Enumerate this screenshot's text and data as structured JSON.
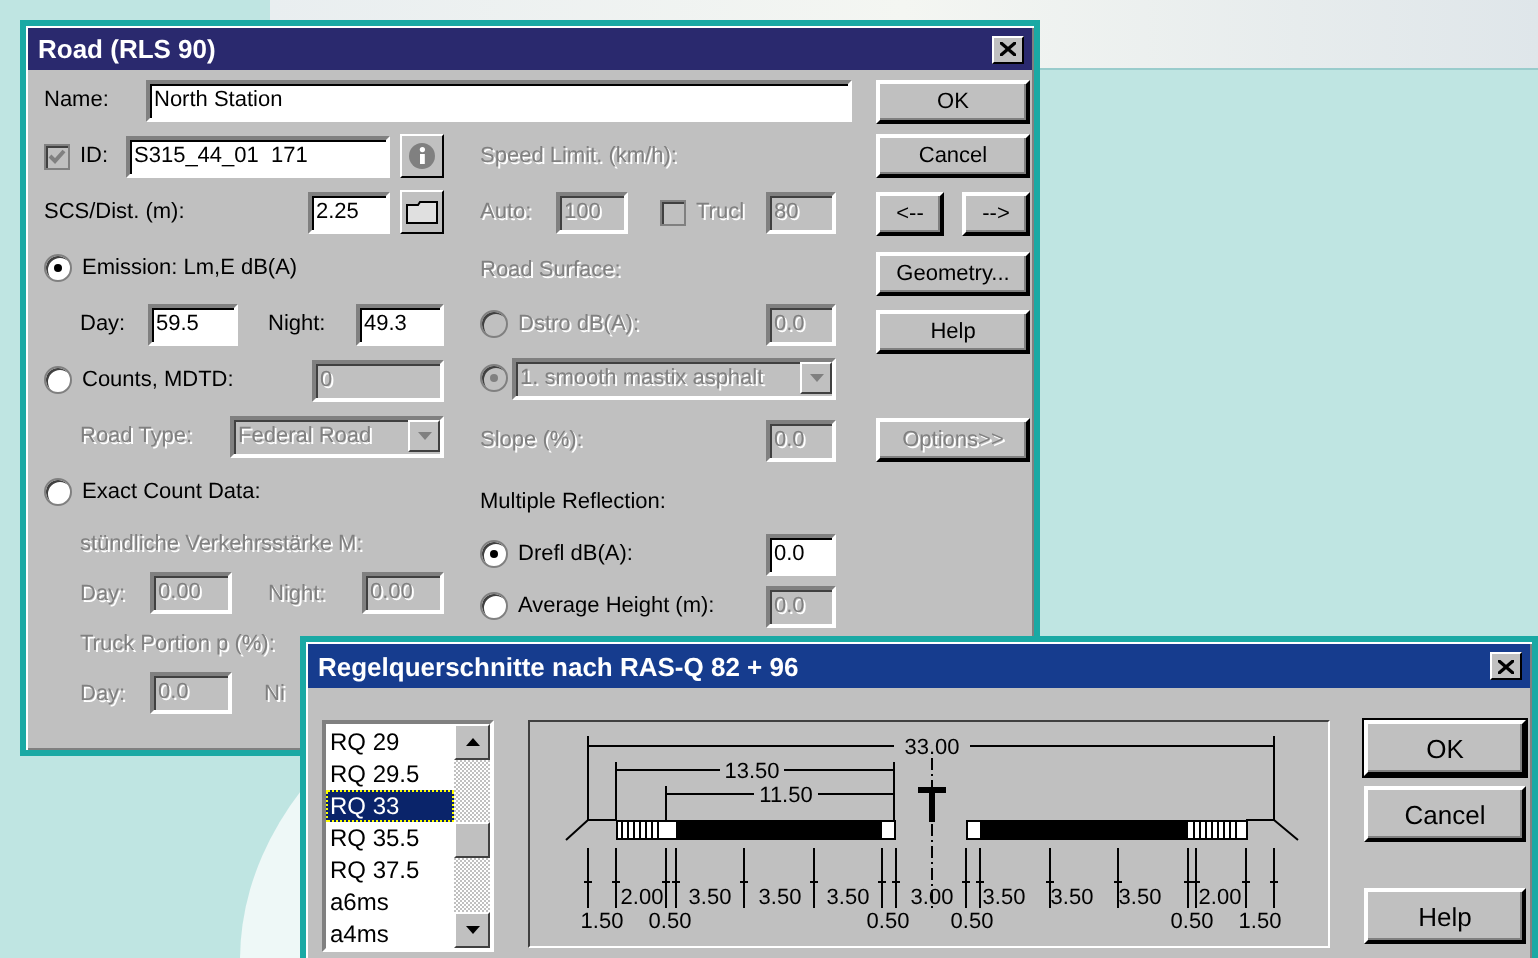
{
  "road_dialog": {
    "title": "Road (RLS 90)",
    "name": {
      "label": "Name:",
      "value": "North Station"
    },
    "id": {
      "label": "ID:",
      "checked": true,
      "value": "S315_44_01  171"
    },
    "scs": {
      "label": "SCS/Dist. (m):",
      "value": "2.25"
    },
    "emission": {
      "label": "Emission: Lm,E dB(A)",
      "selected": true,
      "day": {
        "label": "Day:",
        "value": "59.5"
      },
      "night": {
        "label": "Night:",
        "value": "49.3"
      }
    },
    "counts": {
      "label": "Counts, MDTD:",
      "selected": false,
      "disabled": true,
      "value": "0"
    },
    "road_type": {
      "label": "Road Type:",
      "disabled": true,
      "value": "Federal Road"
    },
    "exact_count": {
      "label": "Exact Count Data:",
      "selected": false
    },
    "hourly": {
      "label": "stündliche Verkehrsstärke M:",
      "disabled": true,
      "day": {
        "label": "Day:",
        "value": "0.00"
      },
      "night": {
        "label": "Night:",
        "value": "0.00"
      }
    },
    "truck_portion": {
      "label": "Truck Portion p (%):",
      "disabled": true,
      "day": {
        "label": "Day:",
        "value": "0.0"
      },
      "night": {
        "label": "Ni"
      }
    },
    "speed_limit": {
      "label": "Speed Limit. (km/h):",
      "disabled": true,
      "auto": {
        "label": "Auto:",
        "value": "100"
      },
      "truck": {
        "label": "Trucl",
        "checked": false,
        "value": "80"
      }
    },
    "road_surface": {
      "label": "Road Surface:",
      "disabled": true,
      "dstro": {
        "label": "Dstro dB(A):",
        "selected": false,
        "value": "0.0"
      },
      "surface": {
        "selected": true,
        "value": "1. smooth mastix asphalt"
      }
    },
    "slope": {
      "label": "Slope (%):",
      "disabled": true,
      "value": "0.0"
    },
    "multiple_reflection": {
      "label": "Multiple Reflection:",
      "drefl": {
        "label": "Drefl dB(A):",
        "selected": true,
        "disabled": false,
        "value": "0.0"
      },
      "average_height": {
        "label": "Average Height (m):",
        "selected": false,
        "disabled": true,
        "value": "0.0"
      }
    },
    "buttons": [
      {
        "label": "OK"
      },
      {
        "label": "Cancel"
      }
    ],
    "nav_buttons": [
      {
        "label": "<--"
      },
      {
        "label": "-->"
      }
    ],
    "more_buttons": [
      {
        "label": "Geometry..."
      },
      {
        "label": "Help"
      }
    ],
    "options": {
      "label": "Options>>",
      "disabled": true
    }
  },
  "cross_section_dialog": {
    "title": "Regelquerschnitte nach RAS-Q 82 + 96",
    "list": [
      {
        "label": "RQ 29",
        "selected": false
      },
      {
        "label": "RQ 29.5",
        "selected": false
      },
      {
        "label": "RQ 33",
        "selected": true
      },
      {
        "label": "RQ 35.5",
        "selected": false
      },
      {
        "label": "RQ 37.5",
        "selected": false
      },
      {
        "label": "a6ms",
        "selected": false
      },
      {
        "label": "a4ms",
        "selected": false
      }
    ],
    "diagram": {
      "total": "33.00",
      "carriageway": "13.50",
      "lanes": "11.50",
      "upper_labels": [
        "2.00",
        "3.50",
        "3.50",
        "3.50",
        "3.00",
        "3.50",
        "3.50",
        "3.50",
        "2.00"
      ],
      "lower_labels": [
        "1.50",
        "0.50",
        "0.50",
        "0.50",
        "0.50",
        "1.50"
      ]
    },
    "buttons": [
      {
        "label": "OK"
      },
      {
        "label": "Cancel"
      },
      {
        "label": "Help"
      }
    ]
  }
}
